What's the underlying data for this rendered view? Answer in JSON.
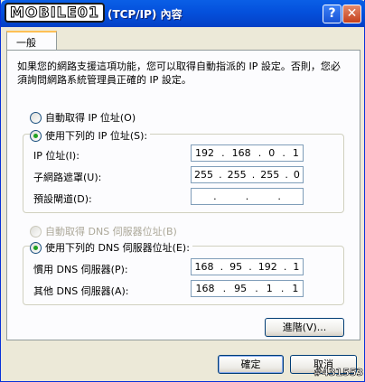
{
  "window": {
    "title": "(TCP/IP) 內容",
    "logo_text": "MOBILE01"
  },
  "tab": {
    "label": "一般"
  },
  "description": "如果您的網路支援這項功能，您可以取得自動指派的 IP 設定。否則，您必須詢問網路系統管理員正確的 IP 設定。",
  "ip_section": {
    "auto_label": "自動取得 IP 位址(O)",
    "manual_label": "使用下列的 IP 位址(S):",
    "fields": [
      {
        "label": "IP 位址(I):",
        "octets": [
          "192",
          "168",
          "0",
          "1"
        ]
      },
      {
        "label": "子網路遮罩(U):",
        "octets": [
          "255",
          "255",
          "255",
          "0"
        ]
      },
      {
        "label": "預設閘道(D):",
        "octets": [
          "",
          "",
          "",
          ""
        ]
      }
    ]
  },
  "dns_section": {
    "auto_label": "自動取得 DNS 伺服器位址(B)",
    "manual_label": "使用下列的 DNS 伺服器位址(E):",
    "fields": [
      {
        "label": "慣用 DNS 伺服器(P):",
        "octets": [
          "168",
          "95",
          "192",
          "1"
        ]
      },
      {
        "label": "其他 DNS 伺服器(A):",
        "octets": [
          "168",
          "95",
          "1",
          "1"
        ]
      }
    ]
  },
  "buttons": {
    "advanced": "進階(V)...",
    "ok": "確定",
    "cancel": "取消"
  },
  "watermark": "#431553"
}
